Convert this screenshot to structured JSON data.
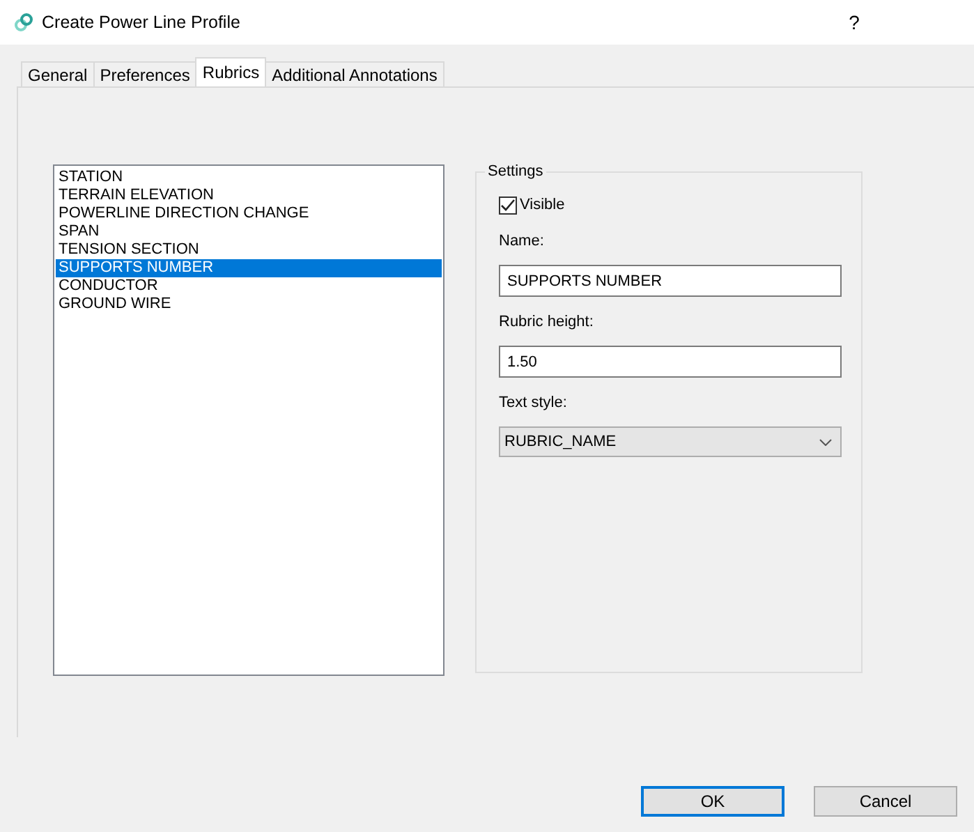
{
  "window": {
    "title": "Create Power Line Profile",
    "help": "?"
  },
  "tabs": [
    {
      "label": "General",
      "selected": false
    },
    {
      "label": "Preferences",
      "selected": false
    },
    {
      "label": "Rubrics",
      "selected": true
    },
    {
      "label": "Additional Annotations",
      "selected": false
    }
  ],
  "rubrics": [
    {
      "label": "STATION",
      "selected": false
    },
    {
      "label": "TERRAIN ELEVATION",
      "selected": false
    },
    {
      "label": "POWERLINE DIRECTION CHANGE",
      "selected": false
    },
    {
      "label": "SPAN",
      "selected": false
    },
    {
      "label": "TENSION SECTION",
      "selected": false
    },
    {
      "label": "SUPPORTS NUMBER",
      "selected": true
    },
    {
      "label": "CONDUCTOR",
      "selected": false
    },
    {
      "label": "GROUND WIRE",
      "selected": false
    }
  ],
  "settings": {
    "title": "Settings",
    "visible": {
      "label": "Visible",
      "checked": true
    },
    "name": {
      "label": "Name:",
      "value": "SUPPORTS NUMBER"
    },
    "rubric_height": {
      "label": "Rubric height:",
      "value": "1.50"
    },
    "text_style": {
      "label": "Text style:",
      "value": "RUBRIC_NAME"
    }
  },
  "buttons": [
    {
      "label": "OK",
      "default": true
    },
    {
      "label": "Cancel",
      "default": false
    }
  ]
}
